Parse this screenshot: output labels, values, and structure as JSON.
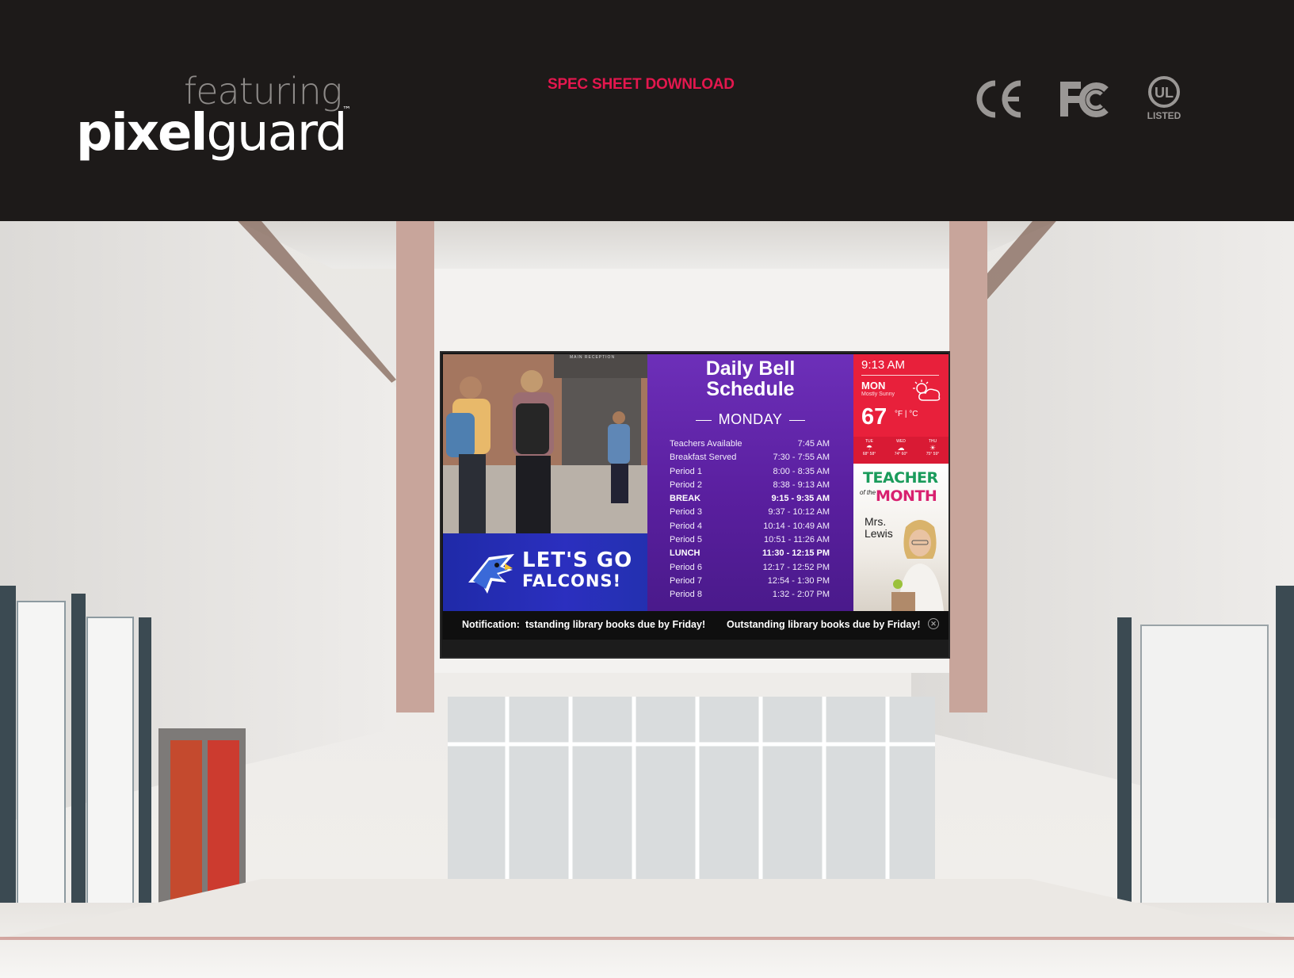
{
  "header": {
    "featuring": "featuring",
    "brand_bold": "pixel",
    "brand_light": "guard",
    "trademark": "™",
    "spec_link": "SPEC SHEET DOWNLOAD",
    "accent_color": "#e4174e",
    "certifications": [
      "CE",
      "FC",
      "UL LISTED"
    ]
  },
  "display": {
    "photo_sign": "MAIN RECEPTION",
    "falcons_line1": "LET'S GO",
    "falcons_line2": "FALCONS!",
    "schedule": {
      "title_line1": "Daily Bell",
      "title_line2": "Schedule",
      "day": "MONDAY",
      "rows": [
        {
          "label": "Teachers Available",
          "time": "7:45 AM"
        },
        {
          "label": "Breakfast Served",
          "time": "7:30 - 7:55 AM"
        },
        {
          "label": "Period 1",
          "time": "8:00 - 8:35 AM"
        },
        {
          "label": "Period 2",
          "time": "8:38 - 9:13 AM"
        },
        {
          "label": "BREAK",
          "time": "9:15 - 9:35 AM"
        },
        {
          "label": "Period 3",
          "time": "9:37 - 10:12 AM"
        },
        {
          "label": "Period 4",
          "time": "10:14 - 10:49 AM"
        },
        {
          "label": "Period 5",
          "time": "10:51 - 11:26 AM"
        },
        {
          "label": "LUNCH",
          "time": "11:30 - 12:15 PM"
        },
        {
          "label": "Period 6",
          "time": "12:17 - 12:52 PM"
        },
        {
          "label": "Period 7",
          "time": "12:54 - 1:30 PM"
        },
        {
          "label": "Period 8",
          "time": "1:32 - 2:07 PM"
        }
      ]
    },
    "weather": {
      "time": "9:13 AM",
      "day": "MON",
      "condition": "Mostly Sunny",
      "temp": "67",
      "units": "°F | °C",
      "forecast": [
        {
          "day": "TUE",
          "temps": "68° 58°"
        },
        {
          "day": "WED",
          "temps": "74° 60°"
        },
        {
          "day": "THU",
          "temps": "75° 59°"
        }
      ]
    },
    "teacher": {
      "word1": "TEACHER",
      "of_the": "of the",
      "word2": "MONTH",
      "name_line1": "Mrs.",
      "name_line2": "Lewis"
    },
    "ticker": {
      "label": "Notification:",
      "message_a": "tstanding library books due by Friday!",
      "message_b": "Outstanding library books due by Friday!"
    }
  }
}
